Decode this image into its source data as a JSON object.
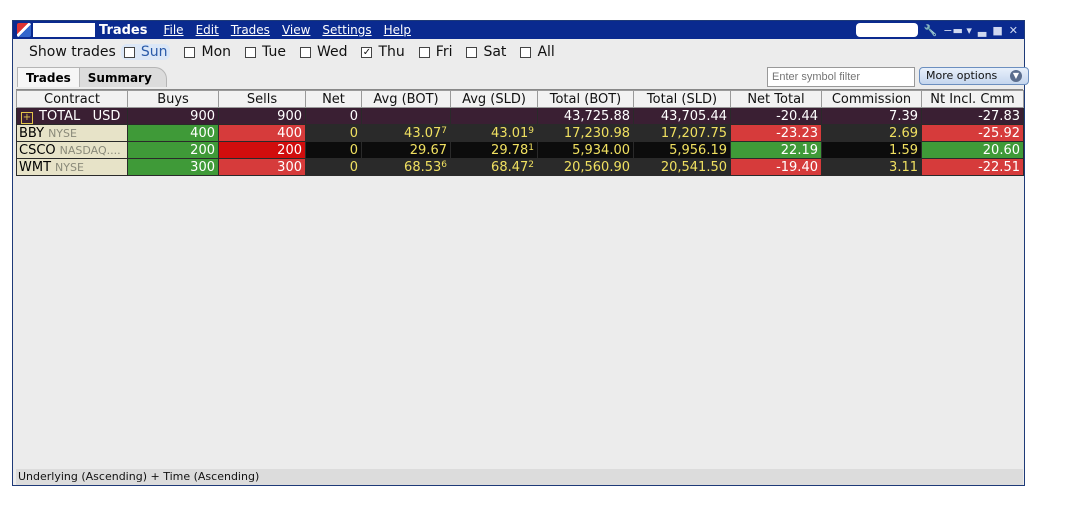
{
  "window": {
    "title": "Trades",
    "menus": [
      "File",
      "Edit",
      "Trades",
      "View",
      "Settings",
      "Help"
    ],
    "title_controls": [
      "wrench-icon",
      "pin-icon",
      "minimize-icon",
      "maximize-icon",
      "close-icon"
    ]
  },
  "show_trades": {
    "label": "Show trades",
    "days": [
      {
        "label": "Sun",
        "checked": false
      },
      {
        "label": "Mon",
        "checked": false
      },
      {
        "label": "Tue",
        "checked": false
      },
      {
        "label": "Wed",
        "checked": false
      },
      {
        "label": "Thu",
        "checked": true
      },
      {
        "label": "Fri",
        "checked": false
      },
      {
        "label": "Sat",
        "checked": false
      },
      {
        "label": "All",
        "checked": false
      }
    ]
  },
  "tabs": [
    "Trades",
    "Summary"
  ],
  "filter": {
    "placeholder": "Enter symbol filter"
  },
  "more_options": "More options",
  "columns": [
    "Contract",
    "Buys",
    "Sells",
    "Net",
    "Avg (BOT)",
    "Avg (SLD)",
    "Total (BOT)",
    "Total (SLD)",
    "Net Total",
    "Commission",
    "Nt Incl. Cmm"
  ],
  "total_row": {
    "label": "TOTAL",
    "currency": "USD",
    "buys": "900",
    "sells": "900",
    "net": "0",
    "avg_bot": "",
    "avg_sld": "",
    "total_bot": "43,725.88",
    "total_sld": "43,705.44",
    "net_total": "-20.44",
    "commission": "7.39",
    "nt_incl": "-27.83"
  },
  "rows": [
    {
      "symbol": "BBY",
      "exchange": "NYSE",
      "buys": "400",
      "sells": "400",
      "net": "0",
      "avg_bot": "43.07",
      "avg_bot_sup": "7",
      "avg_sld": "43.01",
      "avg_sld_sup": "9",
      "total_bot": "17,230.98",
      "total_sld": "17,207.75",
      "net_total": "-23.23",
      "commission": "2.69",
      "nt_incl": "-25.92"
    },
    {
      "symbol": "CSCO",
      "exchange": "NASDAQ....",
      "buys": "200",
      "sells": "200",
      "net": "0",
      "avg_bot": "29.67",
      "avg_bot_sup": "",
      "avg_sld": "29.78",
      "avg_sld_sup": "1",
      "total_bot": "5,934.00",
      "total_sld": "5,956.19",
      "net_total": "22.19",
      "commission": "1.59",
      "nt_incl": "20.60"
    },
    {
      "symbol": "WMT",
      "exchange": "NYSE",
      "buys": "300",
      "sells": "300",
      "net": "0",
      "avg_bot": "68.53",
      "avg_bot_sup": "6",
      "avg_sld": "68.47",
      "avg_sld_sup": "2",
      "total_bot": "20,560.90",
      "total_sld": "20,541.50",
      "net_total": "-19.40",
      "commission": "3.11",
      "nt_incl": "-22.51"
    }
  ],
  "status": "Underlying (Ascending)  +  Time (Ascending)"
}
